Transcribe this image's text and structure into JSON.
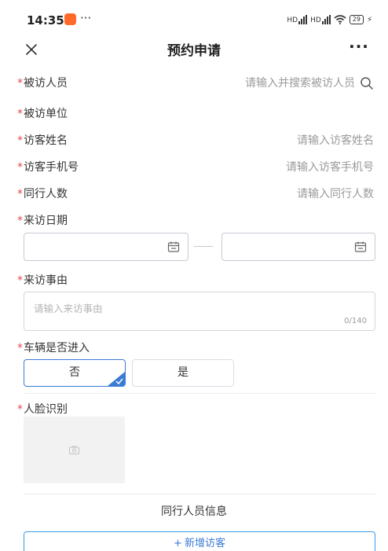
{
  "status_bar": {
    "time": "14:35",
    "more": "···",
    "signal_1": "HD",
    "signal_2": "HD",
    "battery": "29",
    "charge": "⚡"
  },
  "nav": {
    "title": "预约申请",
    "more": "···"
  },
  "required_mark": "*",
  "form": {
    "host": {
      "label": "被访人员",
      "placeholder": "请输入并搜索被访人员"
    },
    "host_unit": {
      "label": "被访单位"
    },
    "visitor_name": {
      "label": "访客姓名",
      "placeholder": "请输入访客姓名"
    },
    "visitor_phone": {
      "label": "访客手机号",
      "placeholder": "请输入访客手机号"
    },
    "companions": {
      "label": "同行人数",
      "placeholder": "请输入同行人数"
    },
    "visit_date": {
      "label": "来访日期"
    },
    "visit_reason": {
      "label": "来访事由",
      "placeholder": "请输入来访事由",
      "counter": "0/140"
    },
    "vehicle": {
      "label": "车辆是否进入",
      "options": [
        "否",
        "是"
      ],
      "selected": "否"
    },
    "face": {
      "label": "人脸识别"
    }
  },
  "companion_section": {
    "title": "同行人员信息",
    "add_button": "新增访客",
    "add_plus": "+"
  },
  "colors": {
    "required": "#e5474a",
    "accent": "#3a7bd5",
    "placeholder": "#9a9a9a",
    "app_icon": "#ff6a2b"
  }
}
